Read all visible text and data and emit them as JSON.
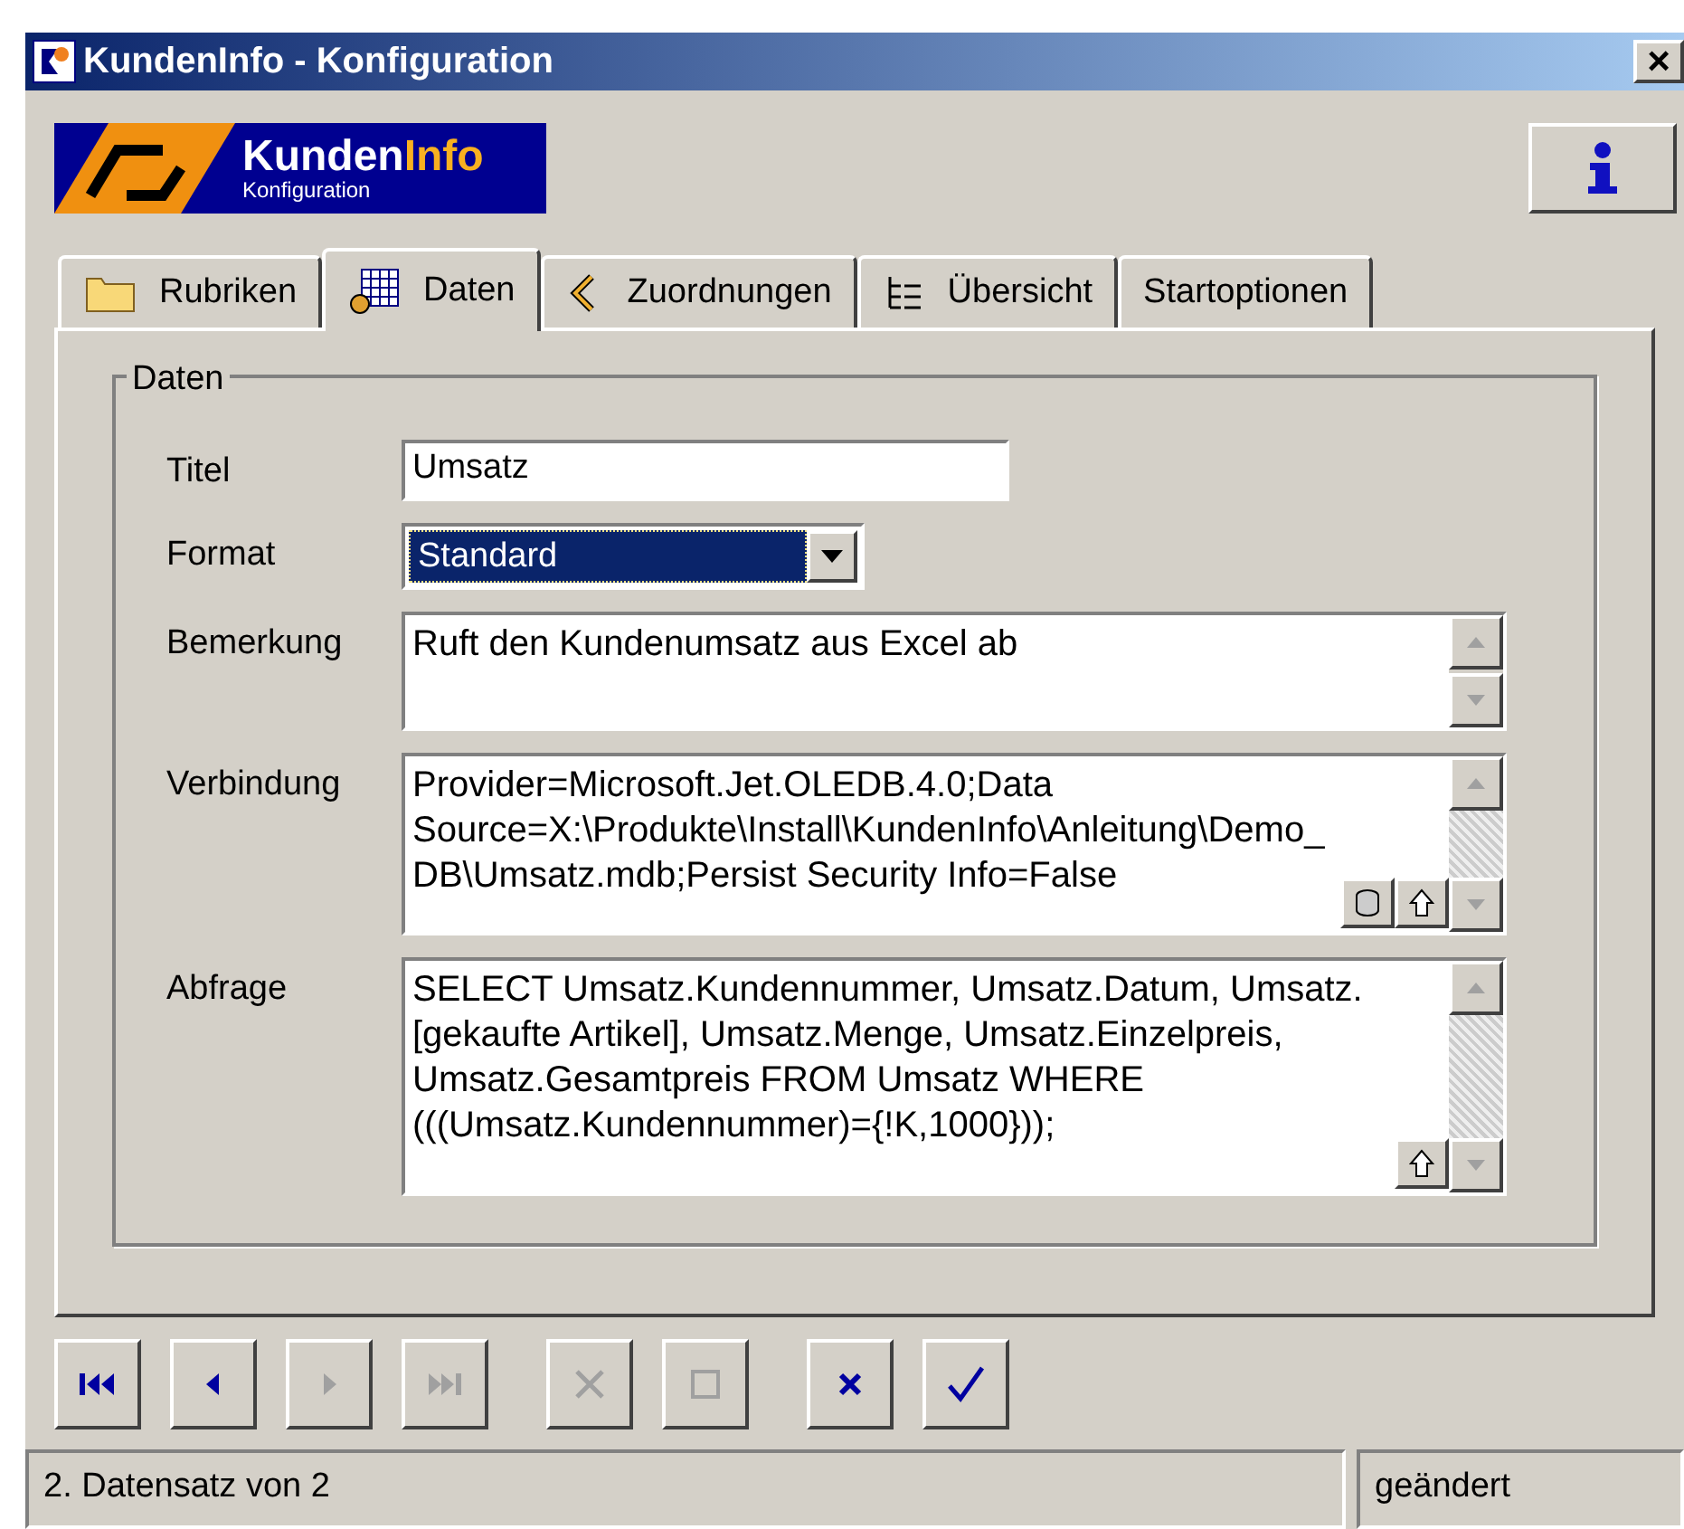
{
  "window": {
    "title": "KundenInfo - Konfiguration",
    "close": "×"
  },
  "logo": {
    "name_a": "Kunden",
    "name_b": "Info",
    "subtitle": "Konfiguration"
  },
  "tabs": [
    {
      "label": "Rubriken",
      "kind": "folder",
      "selected": false
    },
    {
      "label": "Daten",
      "kind": "grid",
      "selected": true
    },
    {
      "label": "Zuordnungen",
      "kind": "link",
      "selected": false
    },
    {
      "label": "Übersicht",
      "kind": "tree",
      "selected": false
    },
    {
      "label": "Startoptionen",
      "kind": "none",
      "selected": false
    }
  ],
  "group": {
    "title": "Daten"
  },
  "fields": [
    {
      "label": "Titel",
      "kind": "text",
      "value": "Umsatz"
    },
    {
      "label": "Format",
      "kind": "select",
      "value": "Standard"
    },
    {
      "label": "Bemerkung",
      "kind": "memo",
      "value": "Ruft den Kundenumsatz aus Excel ab",
      "scrollable": false
    },
    {
      "label": "Verbindung",
      "kind": "memo",
      "value": "Provider=Microsoft.Jet.OLEDB.4.0;Data Source=X:\\Produkte\\Install\\KundenInfo\\Anleitung\\Demo_DB\\Umsatz.mdb;Persist Security Info=False",
      "scrollable": true,
      "database_button": true,
      "shift_button": true
    },
    {
      "label": "Abfrage",
      "kind": "memo",
      "value": "SELECT Umsatz.Kundennummer, Umsatz.Datum, Umsatz.[gekaufte Artikel], Umsatz.Menge, Umsatz.Einzelpreis, Umsatz.Gesamtpreis FROM Umsatz WHERE (((Umsatz.Kundennummer)={!K,1000}));",
      "scrollable": true,
      "shift_button": true
    }
  ],
  "navigator": [
    {
      "kind": "first",
      "disabled": false
    },
    {
      "kind": "prior",
      "disabled": false
    },
    {
      "kind": "next",
      "disabled": true
    },
    {
      "kind": "last",
      "disabled": true
    },
    {
      "kind": "delete",
      "disabled": true
    },
    {
      "kind": "edit",
      "disabled": true
    },
    {
      "kind": "cancel",
      "disabled": false
    },
    {
      "kind": "post",
      "disabled": false
    }
  ],
  "status_bar": [
    "2. Datensatz von 2",
    "geändert"
  ]
}
